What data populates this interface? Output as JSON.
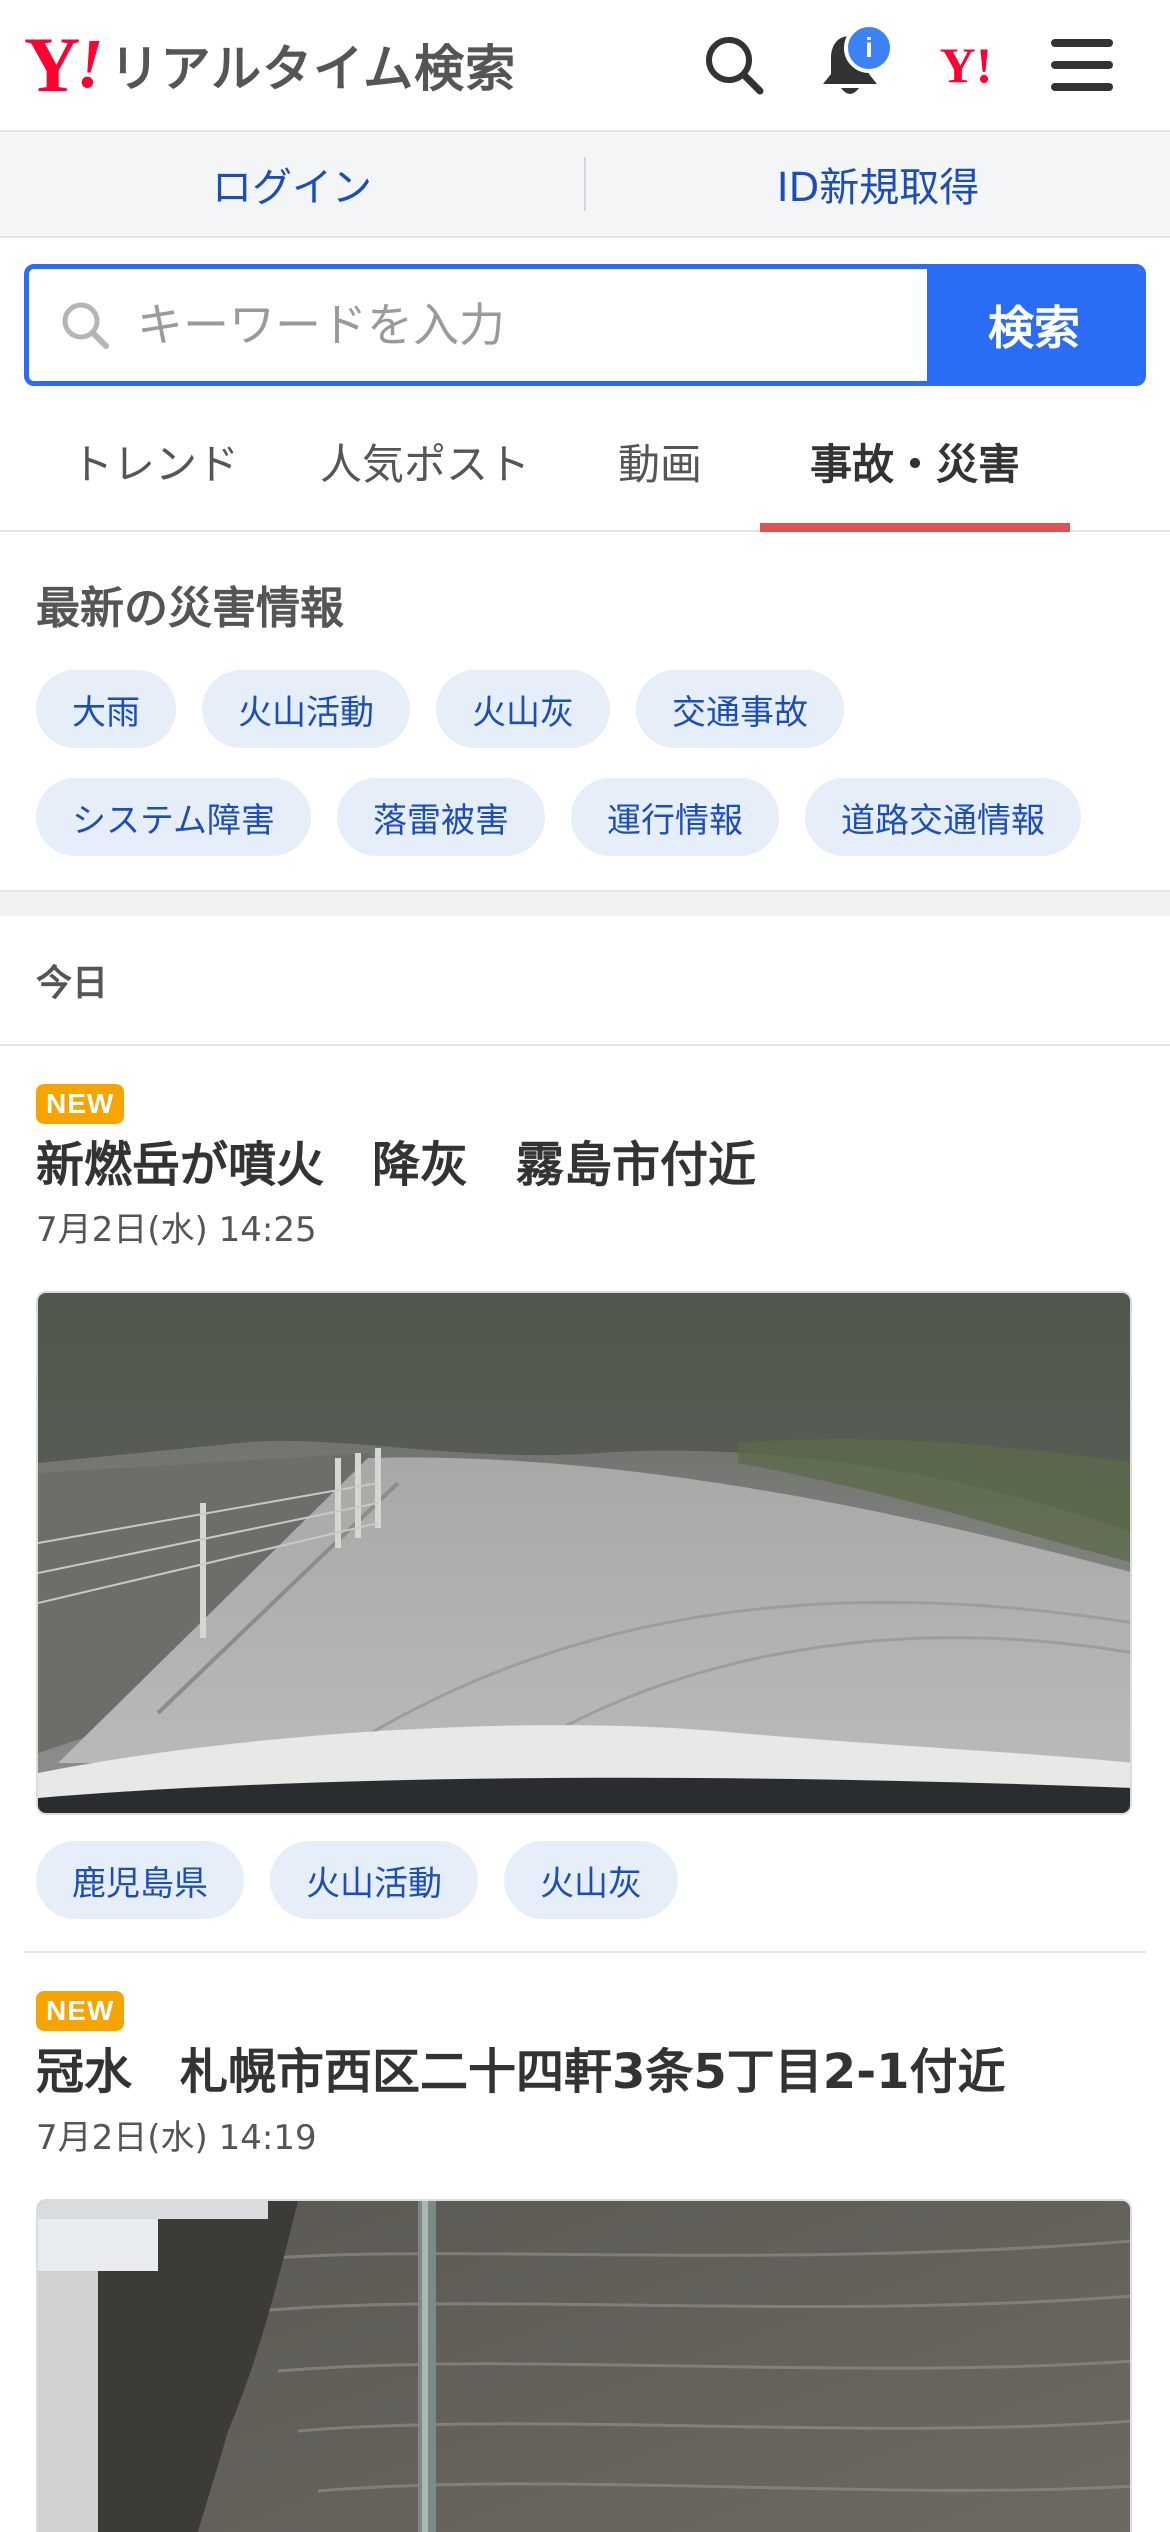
{
  "header": {
    "logo_y": "Y",
    "logo_bang": "!",
    "logo_text": "リアルタイム検索",
    "notification_badge": "i",
    "yahoo_small": "Y!"
  },
  "account_bar": {
    "login": "ログイン",
    "register": "ID新規取得"
  },
  "search": {
    "placeholder": "キーワードを入力",
    "button": "検索"
  },
  "tabs": [
    {
      "label": "トレンド",
      "active": false
    },
    {
      "label": "人気ポスト",
      "active": false
    },
    {
      "label": "動画",
      "active": false
    },
    {
      "label": "事故・災害",
      "active": true
    }
  ],
  "disaster_section": {
    "title": "最新の災害情報",
    "chips": [
      "大雨",
      "火山活動",
      "火山灰",
      "交通事故",
      "システム障害",
      "落雷被害",
      "運行情報",
      "道路交通情報"
    ]
  },
  "day_label": "今日",
  "articles": [
    {
      "badge": "NEW",
      "title": "新燃岳が噴火　降灰　霧島市付近",
      "date": "7月2日(水) 14:25",
      "tags": [
        "鹿児島県",
        "火山活動",
        "火山灰"
      ]
    },
    {
      "badge": "NEW",
      "title": "冠水　札幌市西区二十四軒3条5丁目2-1付近",
      "date": "7月2日(水) 14:19",
      "tags": []
    }
  ],
  "colors": {
    "brand_red": "#ff0033",
    "primary_blue": "#2a6df4",
    "link_blue": "#1d4eb8",
    "chip_bg": "#e6eefa",
    "active_tab_underline": "#e05252",
    "new_badge": "#f7a400"
  }
}
